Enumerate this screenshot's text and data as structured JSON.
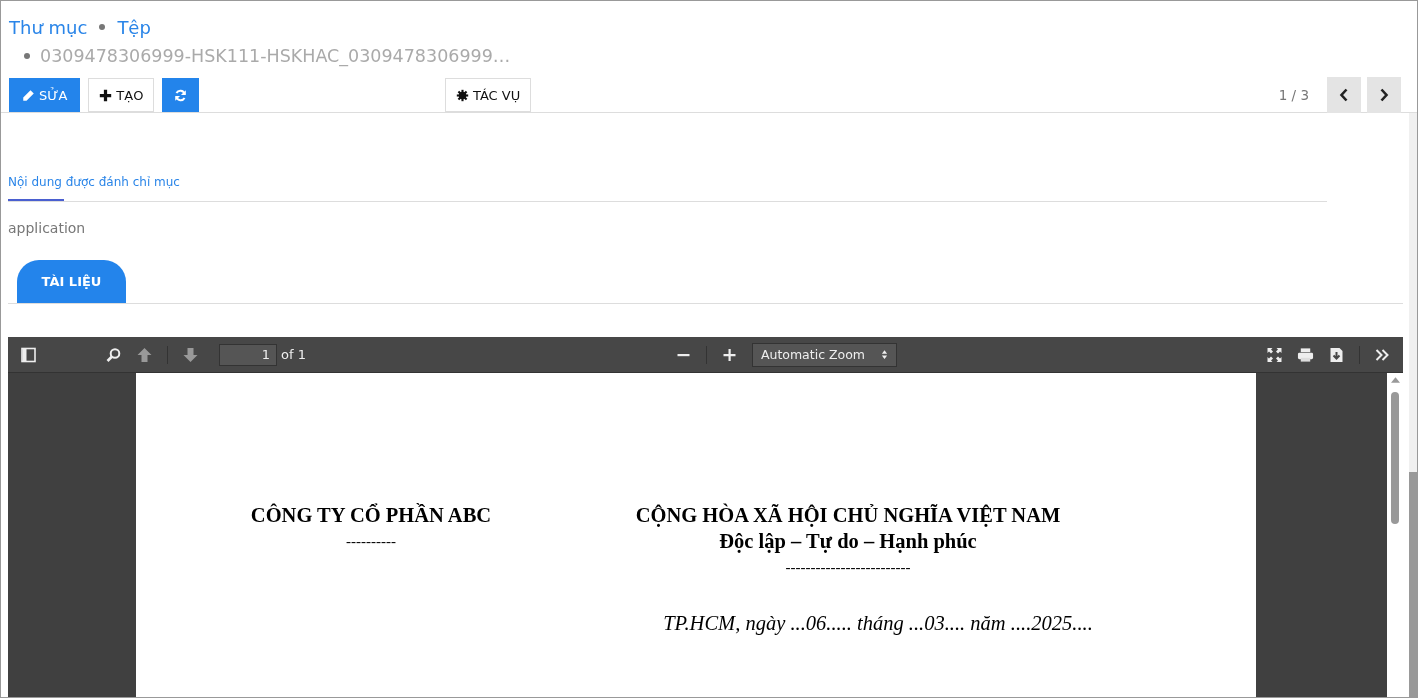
{
  "breadcrumbs": [
    {
      "label": "Thư mục"
    },
    {
      "label": "Tệp"
    }
  ],
  "file_name": "0309478306999-HSK111-HSKHAC_0309478306999…",
  "toolbar": {
    "buttons": [
      {
        "kind": "edit",
        "label": "SỬA"
      },
      {
        "kind": "create",
        "label": "TẠO"
      },
      {
        "kind": "refresh"
      },
      {
        "kind": "actions",
        "label": "TÁC VỤ"
      }
    ],
    "pager": "1 / 3"
  },
  "tabs": [
    {
      "label": "Nội dung được đánh chỉ mục",
      "selected": true
    }
  ],
  "content_text": "application",
  "document_tabs": [
    {
      "label": "TÀI LIỆU",
      "selected": true
    }
  ],
  "pdf_viewer": {
    "page_number": "1",
    "page_count": "of 1",
    "zoom": "Automatic Zoom",
    "document": {
      "left": [
        {
          "kind": "heading",
          "text": "CÔNG TY CỔ PHẦN ABC"
        },
        {
          "kind": "rule",
          "text": "----------"
        }
      ],
      "right": [
        {
          "kind": "heading",
          "text": "CỘNG HÒA XÃ HỘI CHỦ NGHĨA VIỆT NAM"
        },
        {
          "kind": "subheading",
          "text": "Độc lập – Tự do – Hạnh phúc"
        },
        {
          "kind": "rule",
          "text": "-------------------------"
        },
        {
          "kind": "date",
          "text": "TP.HCM, ngày ...06..... tháng ...03.... năm ....2025...."
        }
      ]
    }
  }
}
